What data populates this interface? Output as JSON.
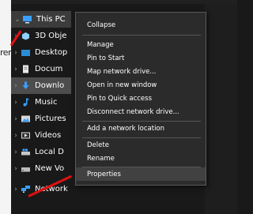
{
  "tree": {
    "items": [
      {
        "label": "This PC",
        "chev": "⌄"
      },
      {
        "label": "3D Obje",
        "chev": "›"
      },
      {
        "label": "Desktop",
        "chev": "›"
      },
      {
        "label": "Docum",
        "chev": "›"
      },
      {
        "label": "Downlo",
        "chev": "›"
      },
      {
        "label": "Music",
        "chev": "›"
      },
      {
        "label": "Pictures",
        "chev": "›"
      },
      {
        "label": "Videos",
        "chev": "›"
      },
      {
        "label": "Local D",
        "chev": "›"
      },
      {
        "label": "New Vo",
        "chev": "›"
      },
      {
        "label": "Network",
        "chev": "›"
      }
    ],
    "left_edge_text": "ren"
  },
  "context_menu": {
    "collapse": "Collapse",
    "manage": "Manage",
    "pin_to_start": "Pin to Start",
    "map_network_drive": "Map network drive...",
    "open_new_window": "Open in new window",
    "pin_quick_access": "Pin to Quick access",
    "disconnect_network_drive": "Disconnect network drive...",
    "add_network_location": "Add a network location",
    "delete": "Delete",
    "rename": "Rename",
    "properties": "Properties"
  },
  "colors": {
    "accent_arrow": "#e01010",
    "menu_bg": "#2b2b2b",
    "explorer_bg": "#191919"
  }
}
